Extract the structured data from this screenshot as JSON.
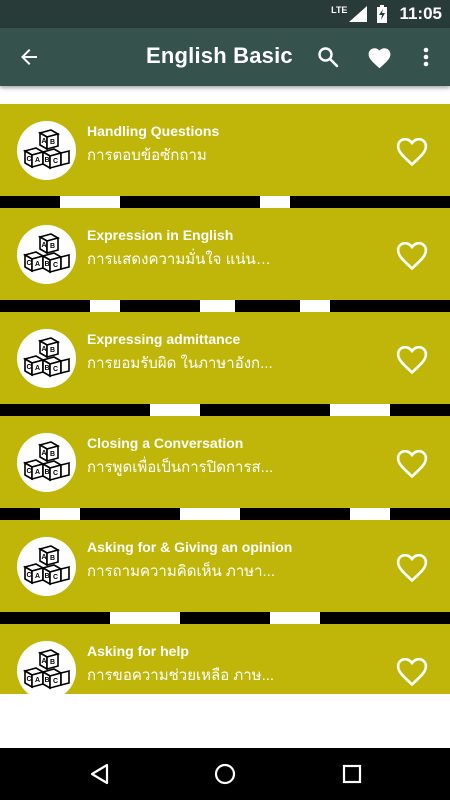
{
  "status_bar": {
    "network": "LTE",
    "time": "11:05"
  },
  "app_bar": {
    "title": "English Basic",
    "icons": [
      "back-arrow-icon",
      "search-icon",
      "heart-icon",
      "more-vert-icon"
    ]
  },
  "colors": {
    "status_bar": "#293b38",
    "app_bar": "#35524c",
    "card": "#c0b60a",
    "nav_bar": "#000000"
  },
  "lessons": [
    {
      "title": "Handling Questions",
      "subtitle": "การตอบข้อซักถาม",
      "icon": "abc-blocks-icon",
      "favorite_icon": "heart-outline-icon"
    },
    {
      "title": "Expression in English",
      "subtitle": "การแสดงความมั่นใจ แน่นอ...",
      "icon": "abc-blocks-icon",
      "favorite_icon": "heart-outline-icon"
    },
    {
      "title": "Expressing admittance",
      "subtitle": "การยอมรับผิด ในภาษาอังก...",
      "icon": "abc-blocks-icon",
      "favorite_icon": "heart-outline-icon"
    },
    {
      "title": "Closing a Conversation",
      "subtitle": "การพูดเพื่อเป็นการปิดการส...",
      "icon": "abc-blocks-icon",
      "favorite_icon": "heart-outline-icon"
    },
    {
      "title": "Asking for & Giving an opinion",
      "subtitle": "การถามความคิดเห็น ภาษา...",
      "icon": "abc-blocks-icon",
      "favorite_icon": "heart-outline-icon"
    },
    {
      "title": "Asking for help",
      "subtitle": "การขอความช่วยเหลือ ภาษ...",
      "icon": "abc-blocks-icon",
      "favorite_icon": "heart-outline-icon"
    }
  ],
  "nav_bar": {
    "icons": [
      "back-triangle-icon",
      "home-circle-icon",
      "recents-square-icon"
    ]
  }
}
